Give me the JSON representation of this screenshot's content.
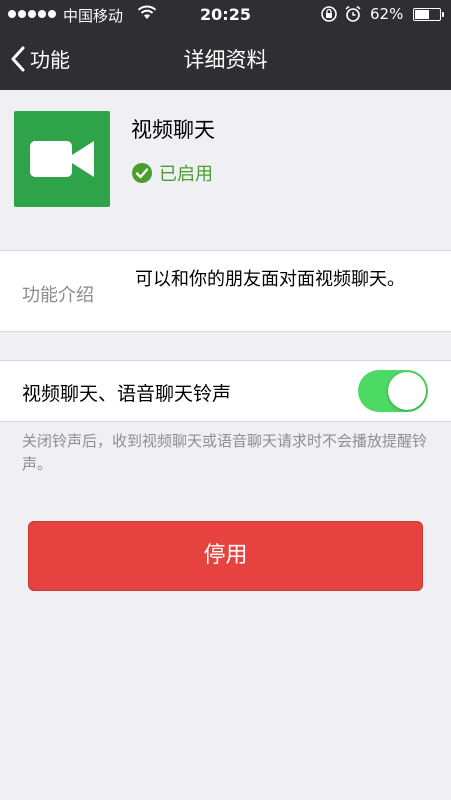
{
  "status_bar": {
    "carrier": "中国移动",
    "time": "20:25",
    "battery_percent": "62%",
    "battery_level": 0.62
  },
  "nav": {
    "back_label": "功能",
    "title": "详细资料"
  },
  "feature": {
    "icon": "video-camera-icon",
    "name": "视频聊天",
    "status": "已启用",
    "accent_color": "#2fa34a"
  },
  "intro": {
    "label": "功能介绍",
    "text": "可以和你的朋友面对面视频聊天。"
  },
  "ringtone": {
    "label": "视频聊天、语音聊天铃声",
    "enabled": true,
    "note": "关闭铃声后，收到视频聊天或语音聊天请求时不会播放提醒铃声。"
  },
  "actions": {
    "disable_label": "停用",
    "disable_color": "#e64340"
  }
}
